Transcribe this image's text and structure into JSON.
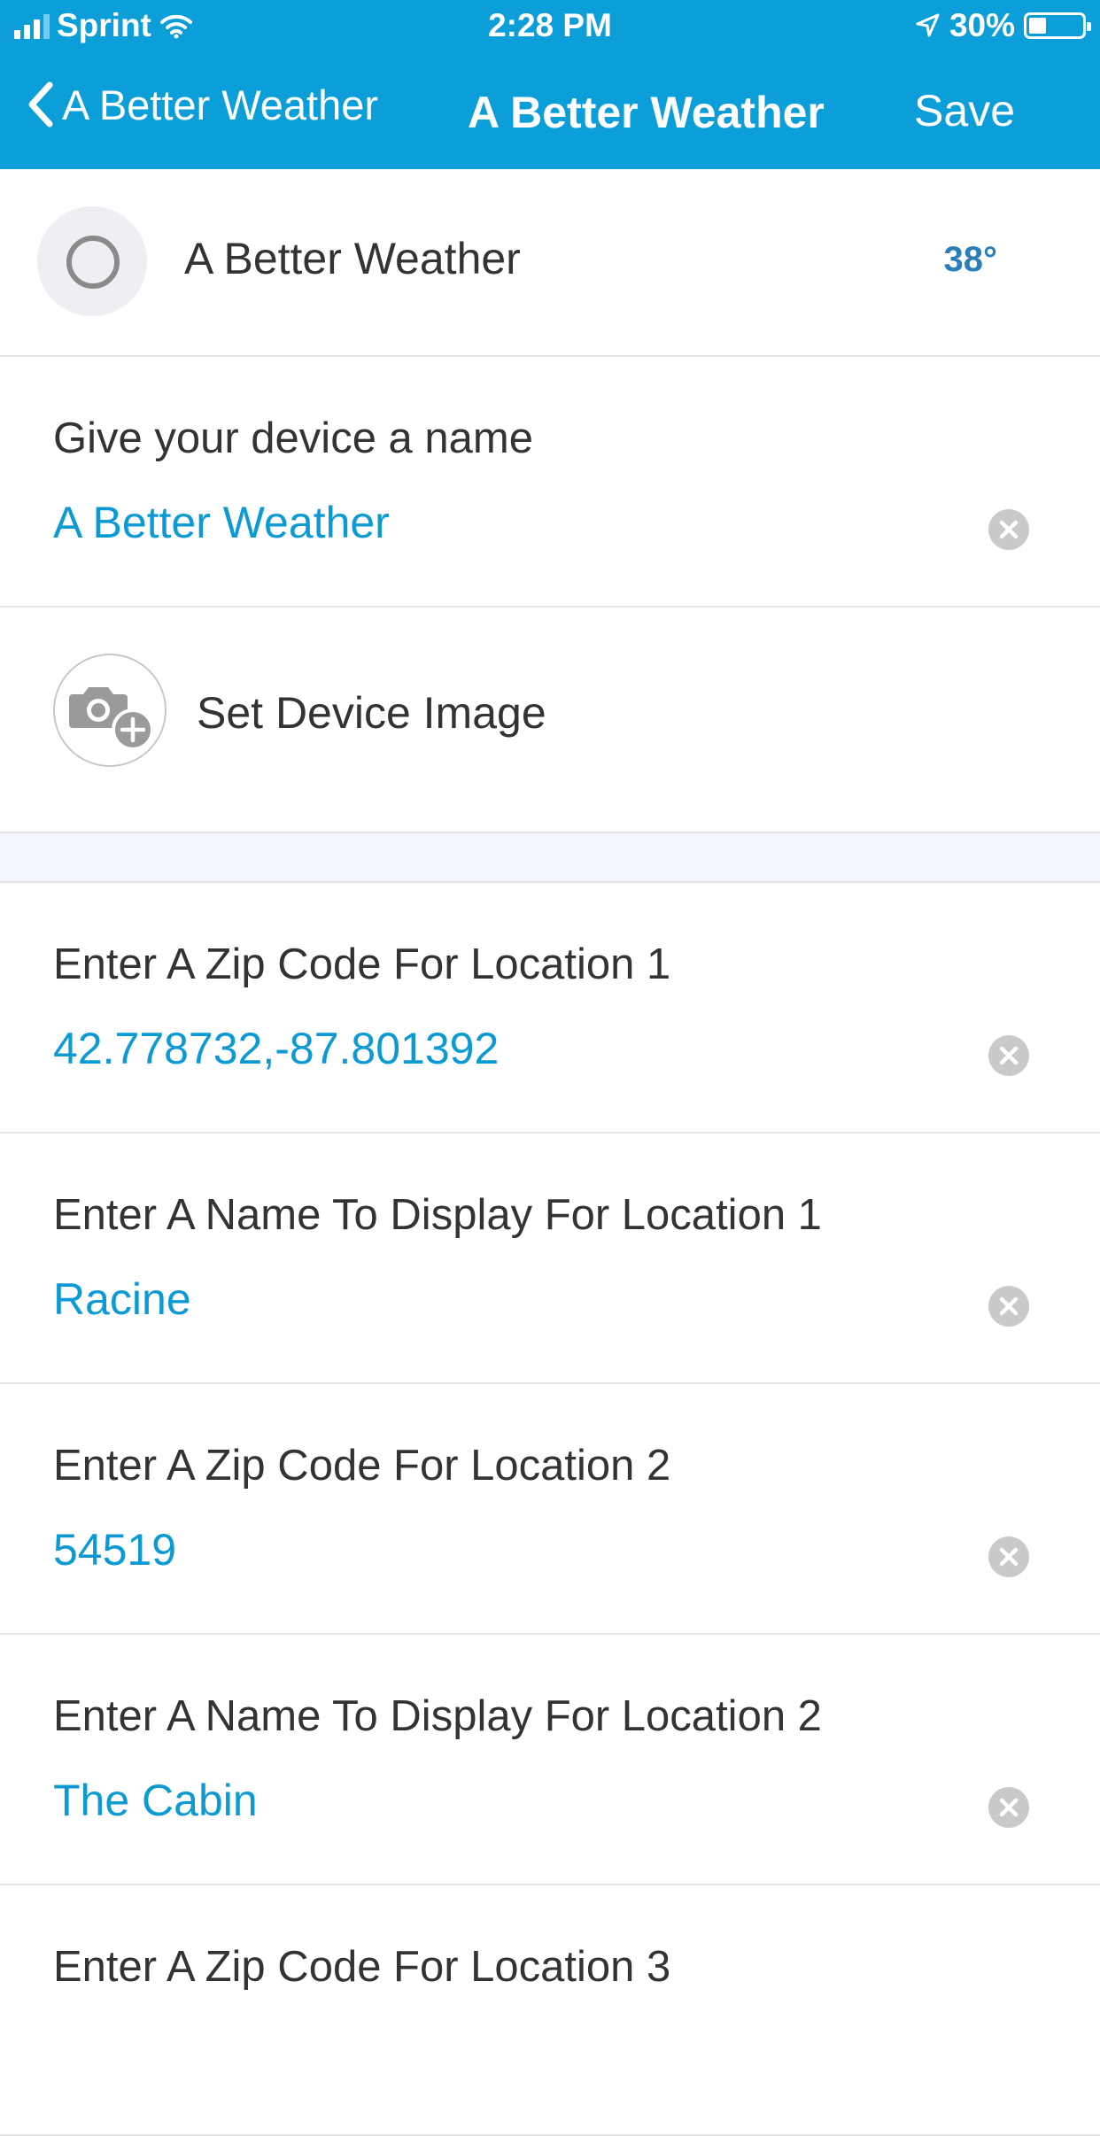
{
  "status_bar": {
    "carrier": "Sprint",
    "time": "2:28 PM",
    "battery": "30%",
    "icons": [
      "signal-icon",
      "wifi-icon",
      "location-arrow-icon",
      "battery-icon"
    ]
  },
  "nav": {
    "back_label": "A Better Weather",
    "title": "A Better Weather",
    "save_label": "Save",
    "back_icon": "chevron-left-icon",
    "color": "#0b9ed9"
  },
  "device": {
    "name": "A Better Weather",
    "temperature": "38°"
  },
  "device_name_field": {
    "label": "Give your device a name",
    "value": "A Better Weather"
  },
  "device_image": {
    "label": "Set Device Image",
    "icon": "camera-add-icon"
  },
  "fields": [
    {
      "label": "Enter A Zip Code For Location 1",
      "value": "42.778732,-87.801392"
    },
    {
      "label": "Enter A Name To Display For Location 1",
      "value": "Racine"
    },
    {
      "label": "Enter A Zip Code For Location 2",
      "value": "54519"
    },
    {
      "label": "Enter A Name To Display For Location 2",
      "value": "The Cabin"
    },
    {
      "label": "Enter A Zip Code For Location 3",
      "value": ""
    }
  ],
  "colors": {
    "accent": "#0c9ad4",
    "temperature": "#2a7fb8",
    "clear_icon": "#c9c9c9"
  }
}
